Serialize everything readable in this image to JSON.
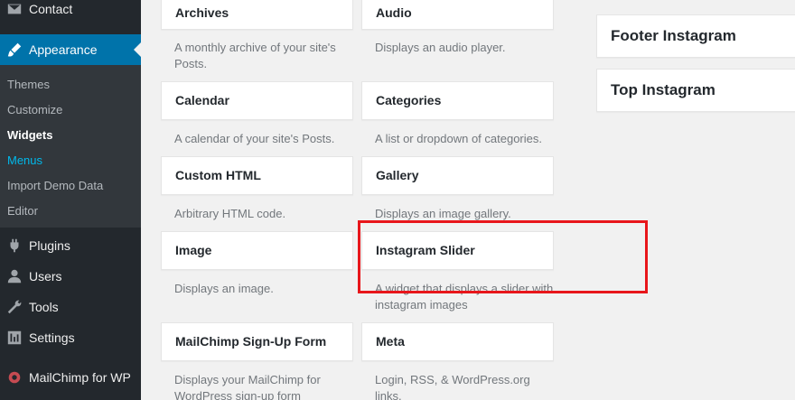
{
  "sidebar": {
    "contact": "Contact",
    "appearance": "Appearance",
    "submenu": {
      "themes": "Themes",
      "customize": "Customize",
      "widgets": "Widgets",
      "menus": "Menus",
      "import_demo": "Import Demo Data",
      "editor": "Editor"
    },
    "plugins": "Plugins",
    "users": "Users",
    "tools": "Tools",
    "settings": "Settings",
    "mailchimp": "MailChimp for WP"
  },
  "widgets": [
    {
      "title": "Archives",
      "desc": "A monthly archive of your site's Posts."
    },
    {
      "title": "Audio",
      "desc": "Displays an audio player."
    },
    {
      "title": "Calendar",
      "desc": "A calendar of your site's Posts."
    },
    {
      "title": "Categories",
      "desc": "A list or dropdown of categories."
    },
    {
      "title": "Custom HTML",
      "desc": "Arbitrary HTML code."
    },
    {
      "title": "Gallery",
      "desc": "Displays an image gallery."
    },
    {
      "title": "Image",
      "desc": "Displays an image."
    },
    {
      "title": "Instagram Slider",
      "desc": "A widget that displays a slider with instagram images"
    },
    {
      "title": "MailChimp Sign-Up Form",
      "desc": "Displays your MailChimp for WordPress sign-up form"
    },
    {
      "title": "Meta",
      "desc": "Login, RSS, & WordPress.org links."
    }
  ],
  "areas": {
    "footer_instagram": "Footer Instagram",
    "top_instagram": "Top Instagram"
  },
  "colors": {
    "sidebar_bg": "#23282d",
    "accent": "#0073aa",
    "highlight": "#e8161b"
  }
}
